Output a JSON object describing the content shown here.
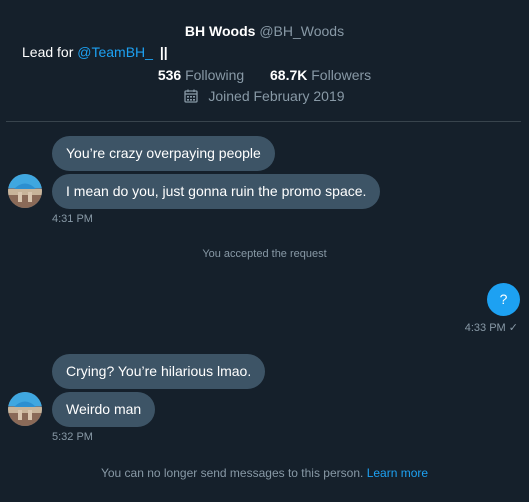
{
  "profile": {
    "display_name": "BH Woods",
    "handle": "@BH_Woods",
    "bio_prefix": "Lead for",
    "bio_mention": "@TeamBH_",
    "bio_suffix": "||",
    "following_count": "536",
    "following_label": "Following",
    "followers_count": "68.7K",
    "followers_label": "Followers",
    "joined": "Joined February 2019"
  },
  "messages": {
    "group1": {
      "bubble1": "You’re crazy overpaying people",
      "bubble2": "I mean do you, just gonna ruin the promo space.",
      "time": "4:31 PM"
    },
    "system_accepted": "You accepted the request",
    "outgoing": {
      "text": "?",
      "time": "4:33 PM ✓"
    },
    "group2": {
      "bubble1": "Crying? You’re hilarious lmao.",
      "bubble2": "Weirdo man",
      "time": "5:32 PM"
    }
  },
  "footer": {
    "notice": "You can no longer send messages to this person.",
    "learn_more": "Learn more"
  },
  "colors": {
    "background": "#15202b",
    "incoming_bubble": "#3d5466",
    "outgoing_bubble": "#1da1f2",
    "muted_text": "#8899a6",
    "link": "#1da1f2"
  },
  "icons": {
    "calendar": "calendar-icon",
    "avatar": "avatar"
  }
}
